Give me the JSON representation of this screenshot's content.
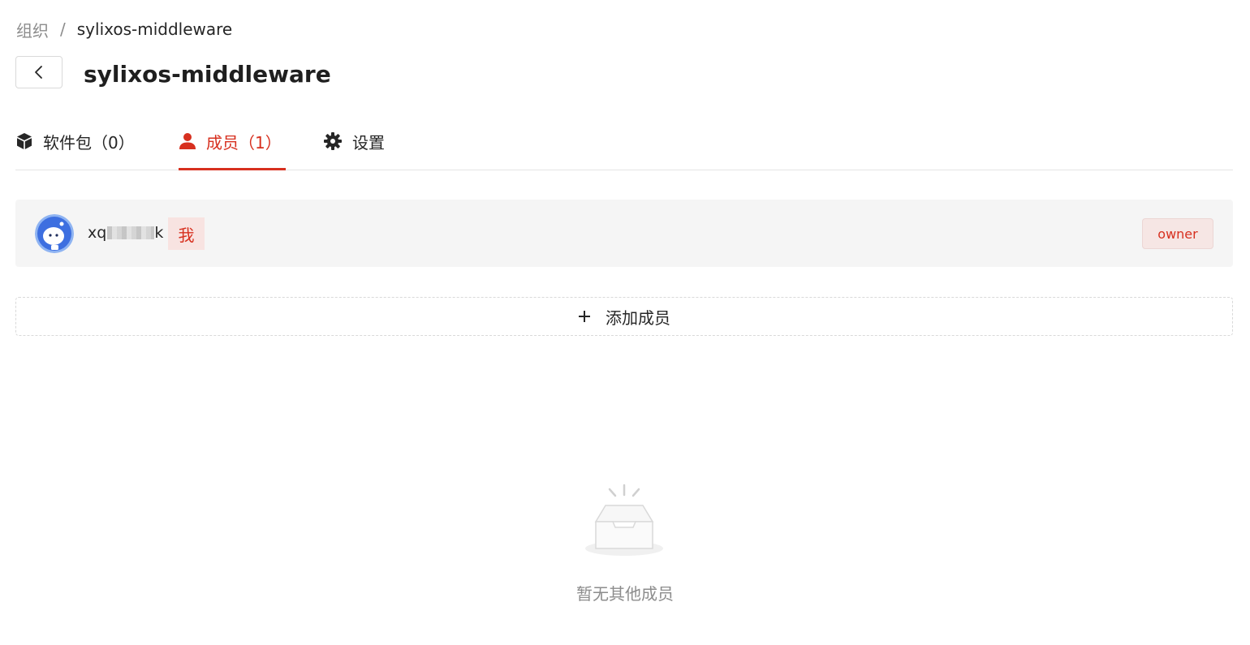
{
  "breadcrumb": {
    "root": "组织",
    "separator": "/",
    "current": "sylixos-middleware"
  },
  "header": {
    "back_icon": "chevron-left-icon",
    "title": "sylixos-middleware"
  },
  "tabs": [
    {
      "label": "软件包（0）",
      "icon": "package-icon",
      "active": false
    },
    {
      "label": "成员（1）",
      "icon": "user-icon",
      "active": true
    },
    {
      "label": "设置",
      "icon": "gear-icon",
      "active": false
    }
  ],
  "members": [
    {
      "name_visible": "xq",
      "name_tail": "k",
      "self_badge": "我",
      "role": "owner"
    }
  ],
  "add_member": {
    "label": "添加成员",
    "icon": "plus-icon"
  },
  "empty": {
    "text": "暂无其他成员",
    "icon": "empty-inbox-icon"
  },
  "colors": {
    "accent": "#d7301f",
    "row_bg": "#f5f5f5",
    "badge_bg": "#f8e3e1",
    "muted_text": "#8c8c8c"
  }
}
